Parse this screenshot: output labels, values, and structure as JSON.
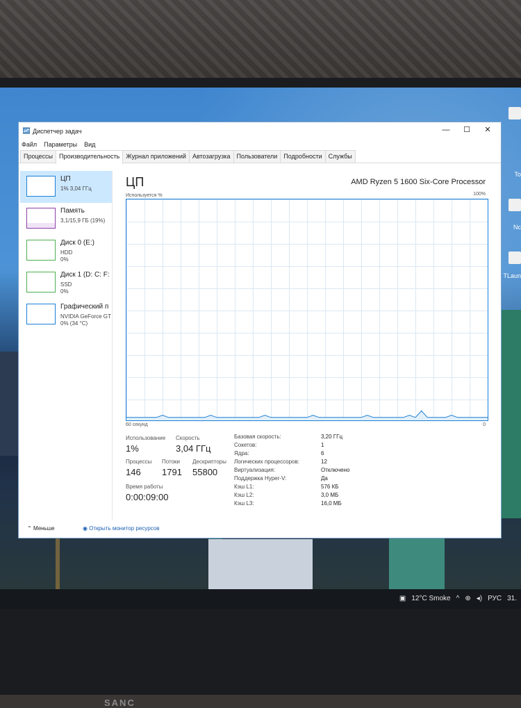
{
  "window": {
    "title": "Диспетчер задач",
    "controls": {
      "minimize": "—",
      "maximize": "☐",
      "close": "✕"
    }
  },
  "menu": [
    "Файл",
    "Параметры",
    "Вид"
  ],
  "tabs": [
    "Процессы",
    "Производительность",
    "Журнал приложений",
    "Автозагрузка",
    "Пользователи",
    "Подробности",
    "Службы"
  ],
  "active_tab": "Производительность",
  "sidebar": {
    "items": [
      {
        "name": "ЦП",
        "line1": "1% 3,04 ГГц",
        "line2": ""
      },
      {
        "name": "Память",
        "line1": "3,1/15,9 ГБ (19%)",
        "line2": ""
      },
      {
        "name": "Диск 0 (E:)",
        "line1": "HDD",
        "line2": "0%"
      },
      {
        "name": "Диск 1 (D: C: F:",
        "line1": "SSD",
        "line2": "0%"
      },
      {
        "name": "Графический п",
        "line1": "NVIDIA GeForce GT",
        "line2": "0% (34 °C)"
      }
    ]
  },
  "main": {
    "title": "ЦП",
    "model": "AMD Ryzen 5 1600 Six-Core Processor",
    "graph_label": "Используется %",
    "graph_max": "100%",
    "axis_left": "60 секунд",
    "axis_right": "0",
    "stats": {
      "usage_label": "Использование",
      "usage_value": "1%",
      "speed_label": "Скорость",
      "speed_value": "3,04 ГГц",
      "processes_label": "Процессы",
      "processes_value": "146",
      "threads_label": "Потоки",
      "threads_value": "1791",
      "handles_label": "Дескрипторы",
      "handles_value": "55800",
      "uptime_label": "Время работы",
      "uptime_value": "0:00:09:00"
    },
    "info": [
      {
        "k": "Базовая скорость:",
        "v": "3,20 ГГц"
      },
      {
        "k": "Сокетов:",
        "v": "1"
      },
      {
        "k": "Ядра:",
        "v": "6"
      },
      {
        "k": "Логических процессоров:",
        "v": "12"
      },
      {
        "k": "Виртуализация:",
        "v": "Отключено"
      },
      {
        "k": "Поддержка Hyper-V:",
        "v": "Да"
      },
      {
        "k": "Кэш L1:",
        "v": "576 КБ"
      },
      {
        "k": "Кэш L2:",
        "v": "3,0 МБ"
      },
      {
        "k": "Кэш L3:",
        "v": "16,0 МБ"
      }
    ],
    "usage_history": [
      1,
      1,
      1,
      1,
      1,
      1,
      2,
      1,
      1,
      1,
      1,
      1,
      1,
      1,
      2,
      1,
      1,
      1,
      1,
      1,
      1,
      1,
      1,
      2,
      1,
      1,
      1,
      1,
      1,
      1,
      1,
      2,
      1,
      1,
      1,
      1,
      1,
      1,
      1,
      1,
      2,
      1,
      1,
      1,
      1,
      1,
      1,
      2,
      1,
      4,
      1,
      1,
      1,
      1,
      2,
      1,
      1,
      1,
      1,
      1,
      1
    ]
  },
  "footer": {
    "less": "Меньше",
    "link": "Открыть монитор ресурсов"
  },
  "taskbar": {
    "weather": "12°C Smoke",
    "lang": "РУС",
    "clock": "31."
  },
  "monitor_brand": "SANC",
  "desktop_labels": [
    "To",
    "Nc",
    "TLaun"
  ]
}
